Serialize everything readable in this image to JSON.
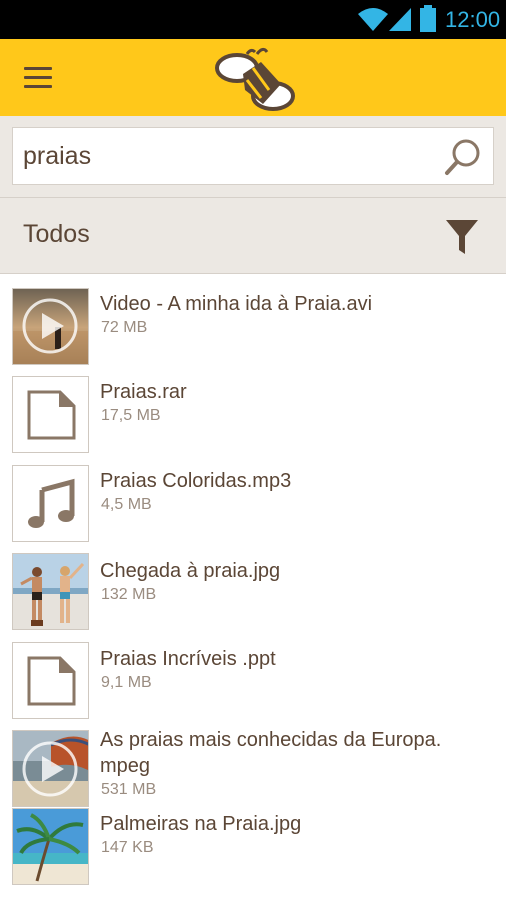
{
  "status_bar": {
    "time": "12:00"
  },
  "search": {
    "query": "praias",
    "placeholder": ""
  },
  "filter": {
    "label": "Todos"
  },
  "colors": {
    "accent": "#ffc81a",
    "text": "#5b4636",
    "muted": "#9a8c80",
    "status_icons": "#33b5e5"
  },
  "files": [
    {
      "name": "Video - A minha ida à Praia.avi",
      "size": "72 MB",
      "thumb": "video-sunset"
    },
    {
      "name": "Praias.rar",
      "size": "17,5 MB",
      "thumb": "document-icon"
    },
    {
      "name": "Praias Coloridas.mp3",
      "size": "4,5 MB",
      "thumb": "music-note-icon"
    },
    {
      "name": "Chegada à praia.jpg",
      "size": "132 MB",
      "thumb": "photo-beach-people"
    },
    {
      "name": "Praias Incríveis .ppt",
      "size": "9,1 MB",
      "thumb": "document-icon"
    },
    {
      "name": "As praias mais conhecidas da Europa.",
      "name2": "mpeg",
      "size": "531 MB",
      "thumb": "video-boat"
    },
    {
      "name": "Palmeiras na Praia.jpg",
      "size": "147 KB",
      "thumb": "photo-palm-beach"
    }
  ]
}
